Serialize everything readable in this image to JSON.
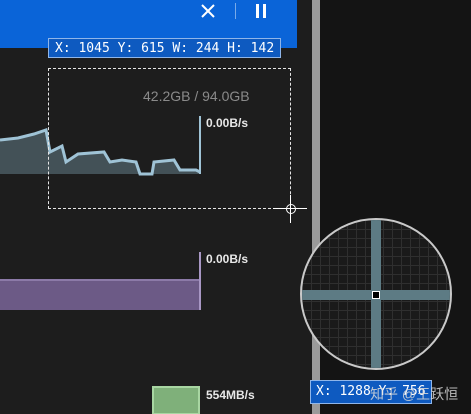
{
  "app": {
    "memory_label": "42.2GB / 94.0GB",
    "rate_1": "0.00B/s",
    "rate_2": "0.00B/s",
    "rate_3": "554MB/s"
  },
  "capture": {
    "top_readout": "X: 1045 Y: 615 W: 244 H: 142",
    "bottom_readout": "X: 1288 Y: 756"
  },
  "watermark": "知乎 @王跃恒",
  "colors": {
    "titlebar": "#0a64d8",
    "readout_bg": "#0e5ac0",
    "chart1_line": "#9fc3d6",
    "chart2_fill": "#6c5a86",
    "chart3_fill": "#7fb07a",
    "magnifier_cross": "#5d7b84"
  },
  "icons": {
    "close": "close-icon",
    "pause": "pause-icon"
  }
}
